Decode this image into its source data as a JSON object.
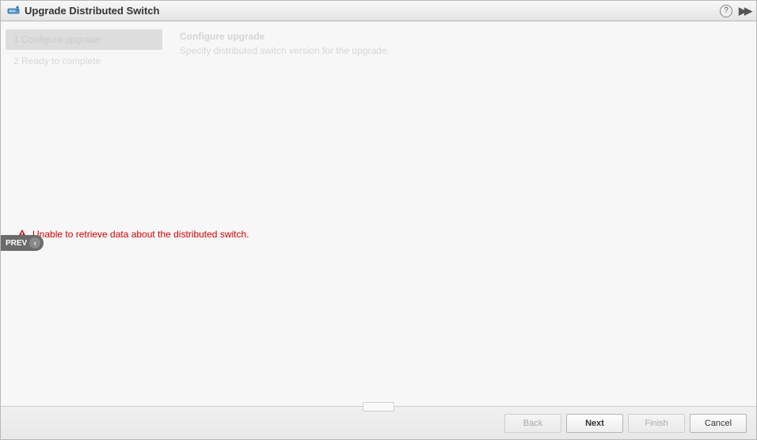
{
  "titlebar": {
    "title": "Upgrade Distributed Switch",
    "help_glyph": "?"
  },
  "sidebar": {
    "steps": [
      {
        "label": "1 Configure upgrade",
        "active": true
      },
      {
        "label": "2 Ready to complete",
        "active": false
      },
      {
        "label": "",
        "active": false
      }
    ]
  },
  "main": {
    "title": "Configure upgrade",
    "subtitle": "Specify distributed switch version for the upgrade."
  },
  "error": {
    "message": "Unable to retrieve data about the distributed switch."
  },
  "prev_badge": {
    "label": "PREV",
    "chevron": "‹"
  },
  "footer": {
    "back": "Back",
    "next": "Next",
    "finish": "Finish",
    "cancel": "Cancel"
  }
}
